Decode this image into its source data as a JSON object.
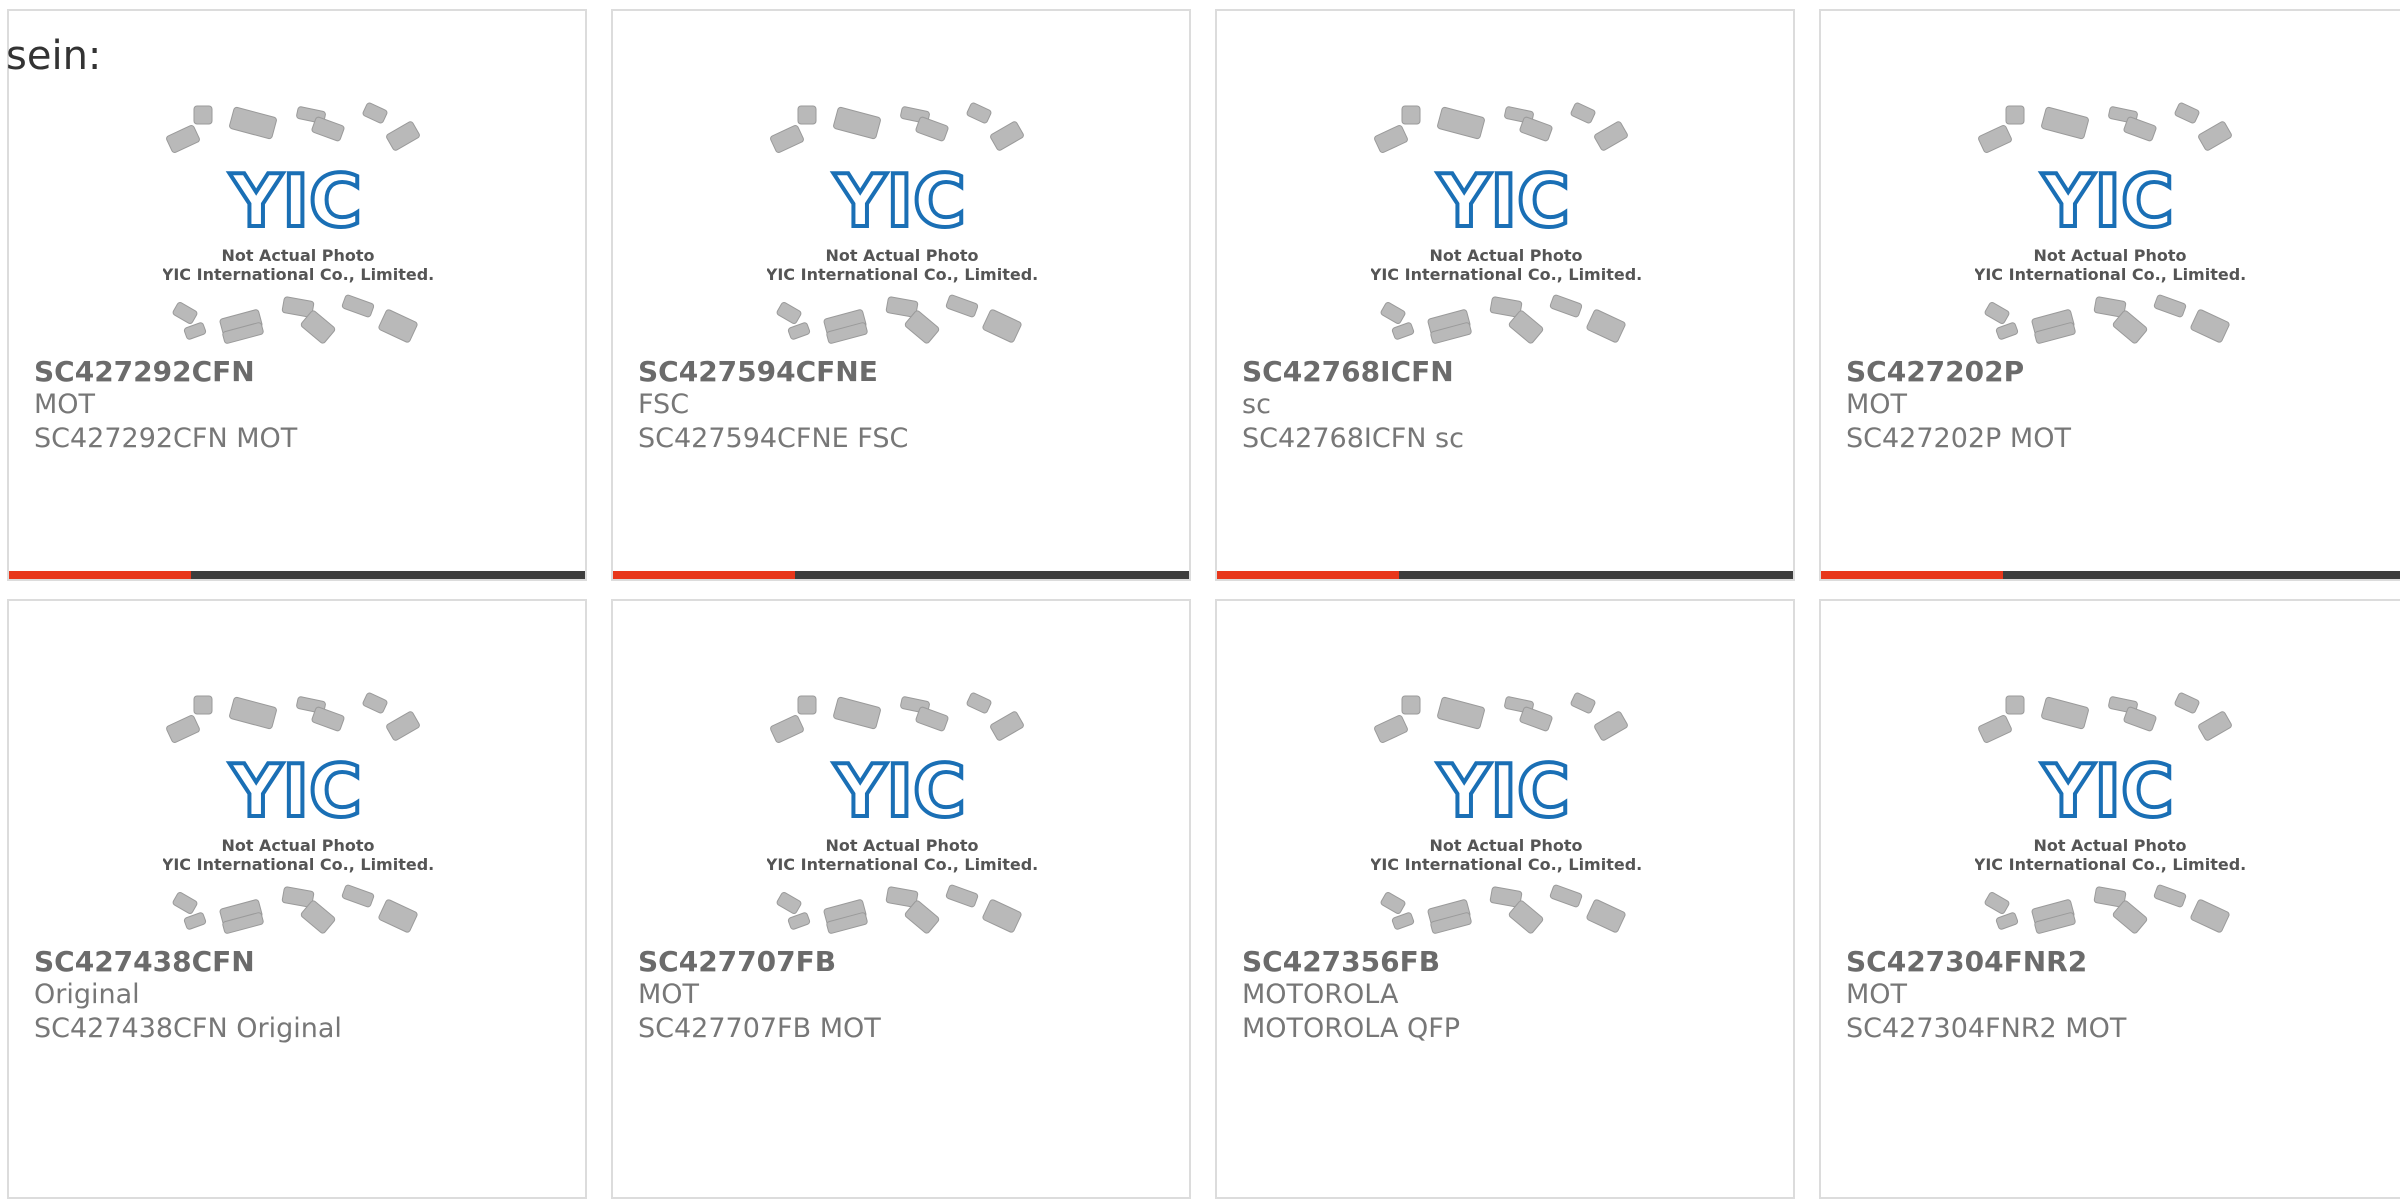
{
  "intro": "sein:",
  "thumbnail": {
    "logo_text": "YIC",
    "caption_line1": "Not Actual Photo",
    "caption_line2": "YIC International Co., Limited."
  },
  "products": [
    {
      "part": "SC427292CFN",
      "maker": "MOT",
      "desc": "SC427292CFN MOT"
    },
    {
      "part": "SC427594CFNE",
      "maker": "FSC",
      "desc": "SC427594CFNE FSC"
    },
    {
      "part": "SC42768ICFN",
      "maker": "sc",
      "desc": "SC42768ICFN sc"
    },
    {
      "part": "SC427202P",
      "maker": "MOT",
      "desc": "SC427202P MOT"
    },
    {
      "part": "SC427438CFN",
      "maker": "Original",
      "desc": "SC427438CFN Original"
    },
    {
      "part": "SC427707FB",
      "maker": "MOT",
      "desc": "SC427707FB MOT"
    },
    {
      "part": "SC427356FB",
      "maker": "MOTOROLA",
      "desc": "MOTOROLA QFP"
    },
    {
      "part": "SC427304FNR2",
      "maker": "MOT",
      "desc": "SC427304FNR2 MOT"
    }
  ],
  "colors": {
    "accent": "#e8371b",
    "bar": "#3d3d3d",
    "logo": "#1a6fb5"
  }
}
